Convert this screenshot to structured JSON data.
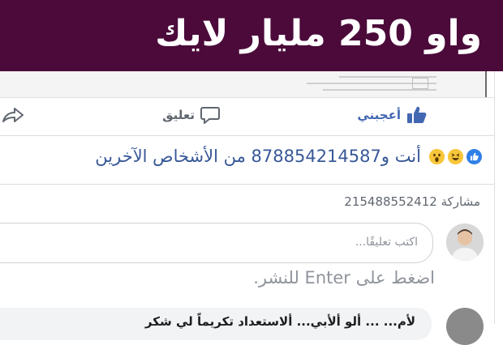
{
  "banner": {
    "title": "واو 250 مليار لايك"
  },
  "post_actions": {
    "like_label": "أعجبني",
    "comment_label": "تعليق"
  },
  "reactions": {
    "summary_text": "أنت و878854214587 من الأشخاص الآخرين",
    "icons": [
      "like-icon",
      "haha-icon",
      "wow-icon"
    ]
  },
  "shares": {
    "text": "مشاركة 215488552412"
  },
  "comment": {
    "placeholder": "اكتب تعليقًا...",
    "hint": "اضغط على Enter للنشر."
  },
  "reply": {
    "text": "لأم... ... ألو ألأبي... ألاستعداد تكريماً لي شكر"
  },
  "colors": {
    "banner_bg": "#4b0a3a",
    "link_blue": "#385898",
    "like_blue": "#4267b2",
    "muted": "#90949c"
  }
}
